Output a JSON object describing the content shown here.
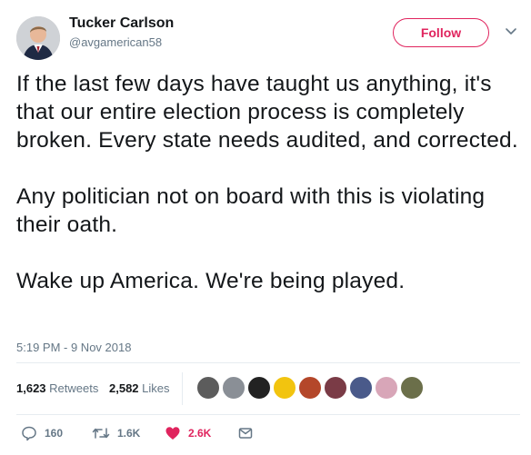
{
  "author": {
    "display_name": "Tucker Carlson",
    "handle": "@avgamerican58"
  },
  "follow_label": "Follow",
  "tweet": {
    "paragraphs": [
      "If the last few days have taught us anything, it's that our entire election process is completely broken. Every state needs audited, and corrected.",
      "Any politician not on board with this is violating their oath.",
      "Wake up America. We're being played."
    ],
    "timestamp": "5:19 PM - 9 Nov 2018"
  },
  "stats": {
    "retweets_count": "1,623",
    "retweets_label": "Retweets",
    "likes_count": "2,582",
    "likes_label": "Likes"
  },
  "likers": [
    {
      "icon": "bike-avatar",
      "color": "#5c5c5c"
    },
    {
      "icon": "eagle-avatar",
      "color": "#8a8f96"
    },
    {
      "icon": "cross-avatar",
      "color": "#222222"
    },
    {
      "icon": "emoji-avatar",
      "color": "#f2c40f"
    },
    {
      "icon": "person-avatar",
      "color": "#b4472a"
    },
    {
      "icon": "flag-avatar",
      "color": "#7a3b46"
    },
    {
      "icon": "cat-avatar",
      "color": "#4a5a8a"
    },
    {
      "icon": "woman-avatar",
      "color": "#d8a6b8"
    },
    {
      "icon": "man-avatar",
      "color": "#6b6f4a"
    }
  ],
  "actions": {
    "reply_count": "160",
    "retweet_count": "1.6K",
    "like_count": "2.6K"
  },
  "colors": {
    "accent": "#e0245e",
    "muted": "#657786",
    "text": "#14171a"
  }
}
